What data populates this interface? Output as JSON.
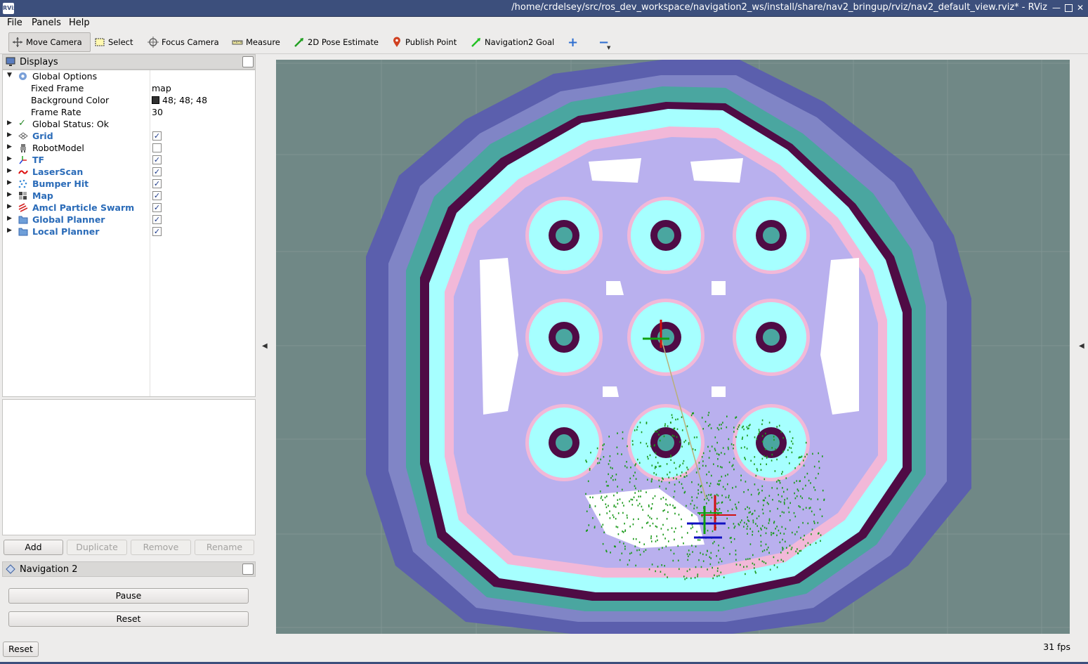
{
  "window": {
    "title": "/home/crdelsey/src/ros_dev_workspace/navigation2_ws/install/share/nav2_bringup/rviz/nav2_default_view.rviz* - RViz",
    "app_icon_text": "RViz"
  },
  "menu": [
    "File",
    "Panels",
    "Help"
  ],
  "toolbar": {
    "tools": [
      {
        "label": "Move Camera",
        "icon": "move-camera-icon",
        "active": true
      },
      {
        "label": "Select",
        "icon": "select-icon"
      },
      {
        "label": "Focus Camera",
        "icon": "focus-camera-icon"
      },
      {
        "label": "Measure",
        "icon": "measure-icon"
      },
      {
        "label": "2D Pose Estimate",
        "icon": "pose-estimate-icon"
      },
      {
        "label": "Publish Point",
        "icon": "publish-point-icon"
      },
      {
        "label": "Navigation2 Goal",
        "icon": "nav-goal-icon"
      }
    ],
    "add_glyph": "+",
    "remove_glyph": "−"
  },
  "displays": {
    "title": "Displays",
    "global_options": "Global Options",
    "fixed_frame": {
      "label": "Fixed Frame",
      "value": "map"
    },
    "background_color": {
      "label": "Background Color",
      "value": "48; 48; 48",
      "color": "#303030"
    },
    "frame_rate": {
      "label": "Frame Rate",
      "value": "30"
    },
    "global_status": "Global Status: Ok",
    "items": [
      {
        "label": "Grid",
        "checked": true,
        "blue": true
      },
      {
        "label": "RobotModel",
        "checked": false,
        "blue": false
      },
      {
        "label": "TF",
        "checked": true,
        "blue": true
      },
      {
        "label": "LaserScan",
        "checked": true,
        "blue": true
      },
      {
        "label": "Bumper Hit",
        "checked": true,
        "blue": true
      },
      {
        "label": "Map",
        "checked": true,
        "blue": true
      },
      {
        "label": "Amcl Particle Swarm",
        "checked": true,
        "blue": true
      },
      {
        "label": "Global Planner",
        "checked": true,
        "blue": true
      },
      {
        "label": "Local Planner",
        "checked": true,
        "blue": true
      }
    ],
    "check_glyph": "✓",
    "buttons": {
      "add": "Add",
      "duplicate": "Duplicate",
      "remove": "Remove",
      "rename": "Rename"
    }
  },
  "navigation": {
    "title": "Navigation 2",
    "pause": "Pause",
    "reset": "Reset"
  },
  "status": {
    "reset": "Reset",
    "fps": "31 fps"
  },
  "colors": {
    "map_background": "#708886",
    "lethal": "#4f0b45",
    "inscribed": "#4aa6a0",
    "outer_cost": "#5b5fad",
    "inflation_light": "#a6ffff",
    "inflation_mid": "#b9b0ee",
    "free": "#ffffff",
    "particles": "#1a9a1a"
  }
}
